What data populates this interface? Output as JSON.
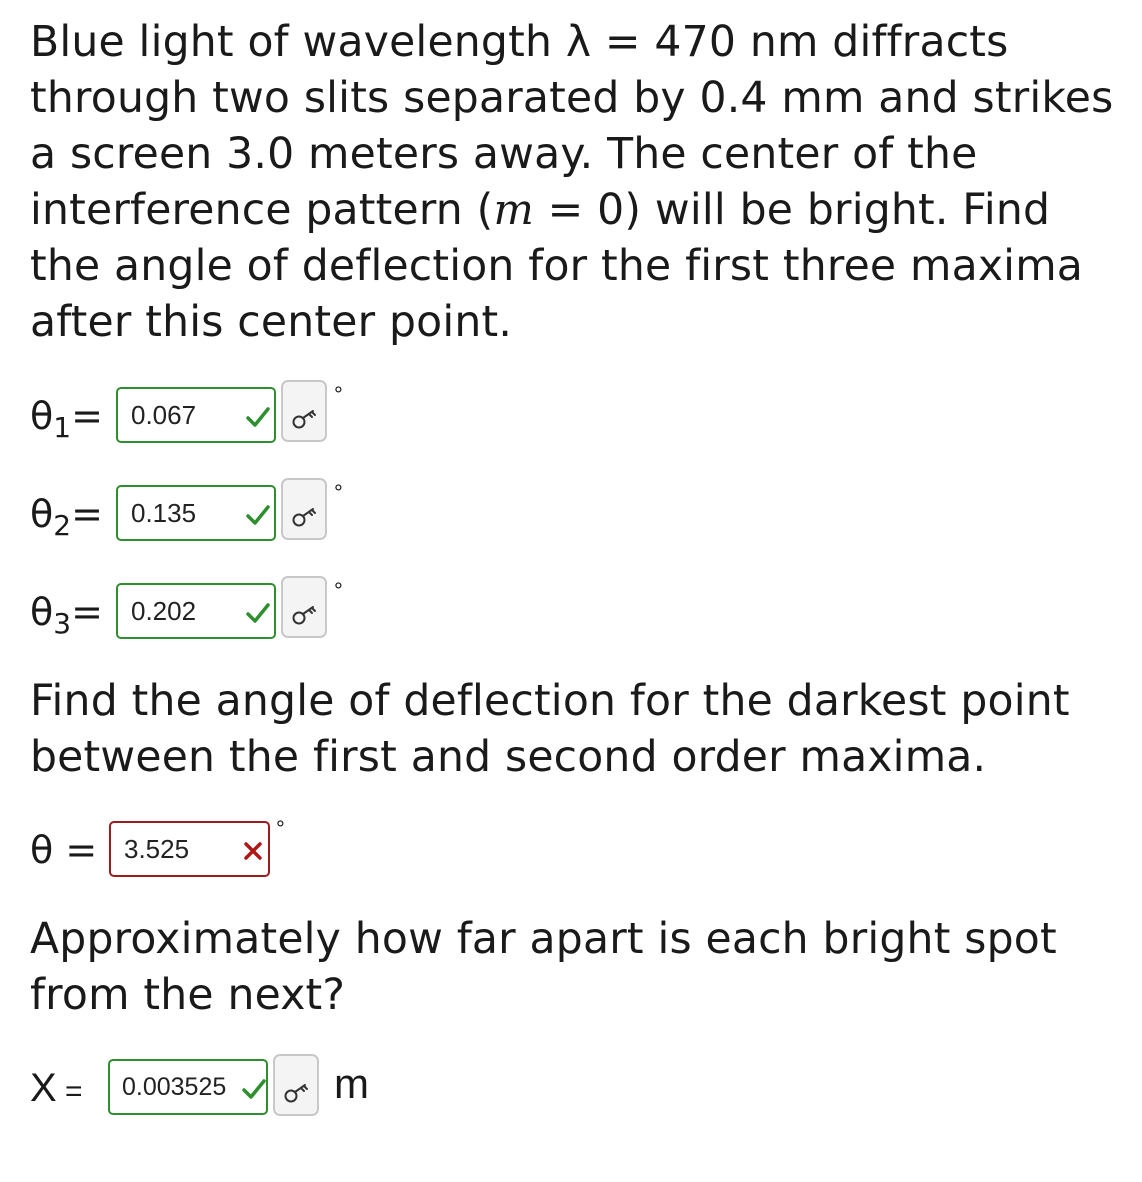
{
  "question": {
    "intro_a": "Blue light of wavelength λ = 470 nm diffracts through two slits separated by 0.4 mm and strikes a screen 3.0 meters away.  The center of the interference pattern (",
    "intro_var": "m",
    "intro_b": " = 0) will be bright. Find the angle of deflection for the first three maxima after this center point.",
    "part2": "Find the angle of deflection for the darkest point between the first and second order maxima.",
    "part3": "Approximately how far apart is each bright spot from the next?"
  },
  "answers": [
    {
      "symbol": "θ",
      "sub": "1",
      "eq": "=",
      "value": "0.067",
      "unit": "°",
      "status": "correct"
    },
    {
      "symbol": "θ",
      "sub": "2",
      "eq": "=",
      "value": "0.135",
      "unit": "°",
      "status": "correct"
    },
    {
      "symbol": "θ",
      "sub": "3",
      "eq": "=",
      "value": "0.202",
      "unit": "°",
      "status": "correct"
    },
    {
      "symbol": "θ",
      "eq": " =",
      "value": "3.525",
      "unit": "°",
      "status": "incorrect"
    },
    {
      "symbol": "X",
      "eq": " =",
      "value": "0.003525",
      "unit": "m",
      "status": "correct"
    }
  ],
  "icons": {
    "correct": "green-checkmark-icon",
    "incorrect": "red-x-icon",
    "key": "key-icon"
  },
  "colors": {
    "correct": "#2e8f2e",
    "incorrect": "#9b1c1c",
    "text": "#1a1a1a"
  }
}
